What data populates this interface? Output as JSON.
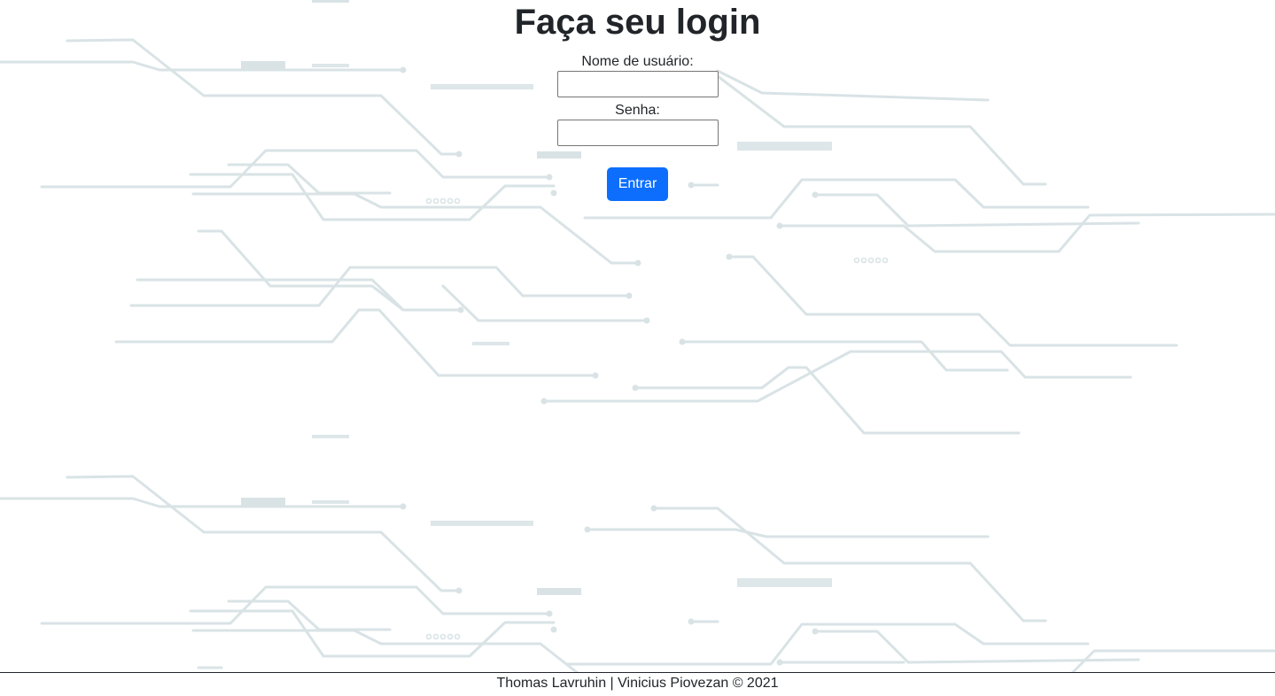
{
  "login": {
    "title": "Faça seu login",
    "username_label": "Nome de usuário:",
    "username_value": "",
    "password_label": "Senha:",
    "password_value": "",
    "submit_label": "Entrar"
  },
  "footer": {
    "text": "Thomas Lavruhin | Vinicius Piovezan © 2021"
  },
  "colors": {
    "background": "#ffffff",
    "circuit": "#d9e3e6",
    "button": "#0d6efd",
    "text": "#212529"
  },
  "icons": {
    "background": "circuit-board-pattern"
  }
}
